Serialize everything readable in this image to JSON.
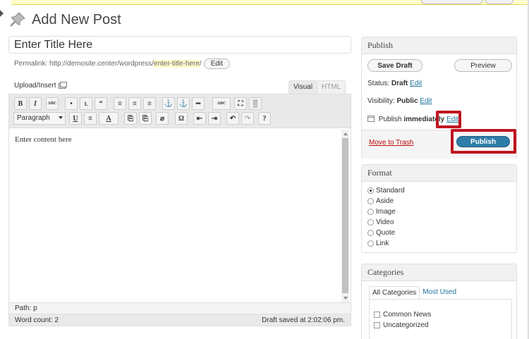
{
  "page": {
    "title": "Add New Post",
    "post_title": "Enter Title Here"
  },
  "permalink": {
    "label": "Permalink:",
    "base": "http://demosite.center/wordpress/",
    "slug": "enter-title-here",
    "trailing": "/",
    "edit_label": "Edit"
  },
  "editor": {
    "upload_label": "Upload/Insert",
    "tabs": [
      "Visual",
      "HTML"
    ],
    "format_select": "Paragraph",
    "content": "Enter content here",
    "path_label": "Path: p",
    "word_count": "Word count: 2",
    "draft_saved": "Draft saved at 2:02:06 pm.",
    "toolbar_row1": [
      "B",
      "I",
      "ABC",
      "•",
      "1.",
      "“",
      "≡",
      "≡",
      "≡",
      "⚓",
      "⚓",
      "━",
      "ABC",
      "⛶",
      "▒"
    ],
    "toolbar_row2": [
      "U",
      "≡",
      "A",
      "⎘",
      "⎘",
      "⌀",
      "Ω",
      "⇤",
      "⇥",
      "↶",
      "↷",
      "?"
    ]
  },
  "publish_box": {
    "heading": "Publish",
    "save_draft": "Save Draft",
    "preview": "Preview",
    "status_label": "Status:",
    "status_value": "Draft",
    "visibility_label": "Visibility:",
    "visibility_value": "Public",
    "publish_label": "Publish",
    "publish_value": "immediately",
    "edit": "Edit",
    "move_to_trash": "Move to Trash",
    "publish_button": "Publish"
  },
  "format_box": {
    "heading": "Format",
    "options": [
      "Standard",
      "Aside",
      "Image",
      "Video",
      "Quote",
      "Link"
    ],
    "selected": "Standard"
  },
  "categories_box": {
    "heading": "Categories",
    "tabs": [
      "All Categories",
      "Most Used"
    ],
    "items": [
      "Common News",
      "Uncategorized"
    ]
  },
  "colors": {
    "link": "#21759b",
    "publish_button": "#2e7ca8",
    "highlight": "#c0131f",
    "trash": "#bc0b0b"
  }
}
